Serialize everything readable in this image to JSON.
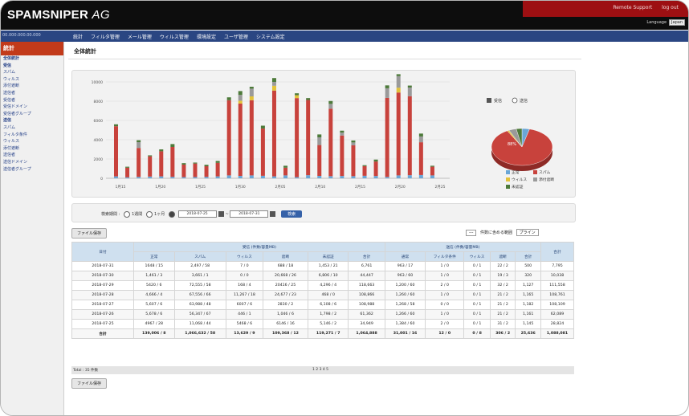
{
  "app": {
    "logo": "SPAMSNIPER",
    "logo_suffix": "AG"
  },
  "header": {
    "links": [
      "Remote Support",
      "log out"
    ],
    "lang_label": "Language",
    "lang_value": "Japan"
  },
  "nav": {
    "left_text": "00.000.000.00.000",
    "items": [
      "統計",
      "フィルタ管理",
      "メール管理",
      "ウィルス管理",
      "環境設定",
      "ユーザ管理",
      "システム設定"
    ]
  },
  "sidebar": {
    "active": "統計",
    "items": [
      {
        "label": "全体統計",
        "sub": true
      },
      {
        "label": "受信",
        "sub": true
      },
      {
        "label": "スパム",
        "sub": false
      },
      {
        "label": "ウィルス",
        "sub": false
      },
      {
        "label": "添付遮断",
        "sub": false
      },
      {
        "label": "",
        "sub": false
      },
      {
        "label": "送信者",
        "sub": false
      },
      {
        "label": "受信者",
        "sub": false
      },
      {
        "label": "受信ドメイン",
        "sub": false
      },
      {
        "label": "受信者グループ",
        "sub": false
      },
      {
        "label": "送信",
        "sub": true
      },
      {
        "label": "スパム",
        "sub": false
      },
      {
        "label": "フィルタ条件",
        "sub": false
      },
      {
        "label": "ウィルス",
        "sub": false
      },
      {
        "label": "添付遮断",
        "sub": false
      },
      {
        "label": "送信者",
        "sub": false
      },
      {
        "label": "送信ドメイン",
        "sub": false
      },
      {
        "label": "送信者グループ",
        "sub": false
      }
    ]
  },
  "page": {
    "title": "全体統計"
  },
  "chart_data": {
    "type": "bar",
    "stacked": true,
    "ylim": [
      0,
      10000
    ],
    "yticks": [
      "10000",
      "8000",
      "6000",
      "4000",
      "2000",
      "0"
    ],
    "xticks": [
      "1月15",
      "1月20",
      "1月25",
      "1月30",
      "2月05",
      "2月10",
      "2月15",
      "2月20",
      "2月25"
    ],
    "legend_top": [
      "受信",
      "送信"
    ],
    "categories": 41,
    "series": [
      {
        "name": "正常",
        "color": "#6aa6d6",
        "values": [
          200,
          100,
          150,
          180,
          200,
          150,
          120,
          130,
          150,
          200,
          300,
          250,
          300,
          260,
          200,
          300,
          120,
          320,
          250,
          220,
          240,
          220,
          260,
          240,
          140,
          300,
          320,
          340,
          300,
          320,
          200,
          120
        ]
      },
      {
        "name": "スパム",
        "color": "#c8423c",
        "values": [
          5200,
          1000,
          3000,
          2100,
          2600,
          3100,
          1300,
          1400,
          1100,
          1400,
          7800,
          7500,
          7800,
          4900,
          8900,
          800,
          8200,
          7800,
          3200,
          7000,
          4200,
          3200,
          1000,
          1500,
          8200,
          8600,
          8200,
          3400,
          900
        ]
      },
      {
        "name": "ウィルス",
        "color": "#e3c23a",
        "values": [
          0,
          0,
          0,
          0,
          0,
          0,
          0,
          0,
          0,
          0,
          0,
          300,
          400,
          0,
          500,
          0,
          300,
          0,
          0,
          0,
          0,
          0,
          0,
          0,
          0,
          500,
          0,
          0,
          0
        ]
      },
      {
        "name": "添付遮断",
        "color": "#9a9a9a",
        "values": [
          0,
          0,
          600,
          0,
          0,
          0,
          0,
          0,
          0,
          0,
          0,
          600,
          800,
          0,
          400,
          0,
          0,
          0,
          800,
          500,
          300,
          300,
          0,
          0,
          1000,
          1200,
          900,
          600,
          0
        ]
      },
      {
        "name": "未認証",
        "color": "#4d7a3a",
        "values": [
          200,
          100,
          200,
          100,
          200,
          300,
          150,
          100,
          150,
          200,
          300,
          400,
          200,
          300,
          400,
          200,
          200,
          200,
          300,
          300,
          200,
          200,
          100,
          200,
          300,
          200,
          200,
          300,
          100
        ]
      }
    ],
    "pie": {
      "slices": [
        {
          "name": "正常",
          "value": 4
        },
        {
          "name": "スパム",
          "value": 88
        },
        {
          "name": "ウィルス",
          "value": 1
        },
        {
          "name": "添付遮断",
          "value": 4
        },
        {
          "name": "未認証",
          "value": 3
        }
      ],
      "label": "88%"
    },
    "pie_legend": [
      "正常",
      "スパム",
      "ウィルス",
      "添付遮断",
      "未認証"
    ]
  },
  "search": {
    "label": "検索期間 :",
    "opt1": "1週間",
    "opt2": "1ヶ月",
    "date_from": "2018-07-25",
    "date_to": "2018-07-31",
    "button": "検索"
  },
  "buttons": {
    "file_save": "ファイル保存"
  },
  "filters": {
    "sel1": "---",
    "label": "件数に含める範囲",
    "sel2": "プライン"
  },
  "table": {
    "group1": "受信 (件数/容量MB)",
    "group2": "送信 (件数/容量MB)",
    "col_date": "日付",
    "col_total": "合計",
    "sub1": [
      "正常",
      "スパム",
      "ウィルス",
      "遮断",
      "未認証",
      "合計"
    ],
    "sub2": [
      "通常",
      "フィルタ条件",
      "ウィルス",
      "遮断",
      "合計"
    ],
    "rows": [
      [
        "2018-07-31",
        "1648 / 15",
        "2,497 / 58",
        "7 / 0",
        "688 / 18",
        "1,453 / 21",
        "6,761",
        "963 / 17",
        "1 / 0",
        "0 / 1",
        "22 / 2",
        "500",
        "7,795"
      ],
      [
        "2018-07-30",
        "1,461 / 3",
        "3,661 / 1",
        "0 / 0",
        "20,668 / 26",
        "6,806 / 10",
        "44,447",
        "963 / 60",
        "1 / 0",
        "0 / 1",
        "19 / 3",
        "320",
        "10,038"
      ],
      [
        "2018-07-29",
        "5420 / 6",
        "72,555 / 58",
        "168 / 4",
        "20416 / 25",
        "4,296 / 4",
        "118,663",
        "1,200 / 60",
        "2 / 0",
        "0 / 1",
        "32 / 2",
        "1,127",
        "111,558"
      ],
      [
        "2018-07-28",
        "4,666 / 4",
        "67,556 / 66",
        "11,267 / 18",
        "24,677 / 23",
        "468 / 0",
        "108,866",
        "1,260 / 60",
        "1 / 0",
        "0 / 1",
        "21 / 2",
        "1,165",
        "108,761"
      ],
      [
        "2018-07-27",
        "5,607 / 6",
        "63,988 / 48",
        "6007 / 6",
        "2830 / 2",
        "6,108 / 6",
        "108,988",
        "1,268 / 58",
        "0 / 0",
        "0 / 1",
        "21 / 2",
        "1,182",
        "108,109"
      ],
      [
        "2018-07-26",
        "5,678 / 6",
        "56,347 / 67",
        "446 / 1",
        "1,046 / 6",
        "1,798 / 2",
        "61,362",
        "1,266 / 60",
        "1 / 0",
        "0 / 1",
        "21 / 2",
        "1,161",
        "62,089"
      ],
      [
        "2018-07-25",
        "4967 / 28",
        "11,068 / 44",
        "5468 / 6",
        "6146 / 16",
        "5,146 / 2",
        "34,949",
        "1,384 / 60",
        "2 / 0",
        "0 / 1",
        "31 / 2",
        "1,145",
        "28,824"
      ]
    ],
    "total": [
      "合計",
      "139,006 / 8",
      "1,066,632 / 58",
      "13,629 / 9",
      "109,368 / 12",
      "119,271 / 7",
      "1,064,888",
      "31,001 / 16",
      "12 / 0",
      "0 / 8",
      "306 / 2",
      "25,636",
      "1,088,081"
    ],
    "footer_left": "Total : 35 件数",
    "pager": "1 2 3 4 5"
  }
}
